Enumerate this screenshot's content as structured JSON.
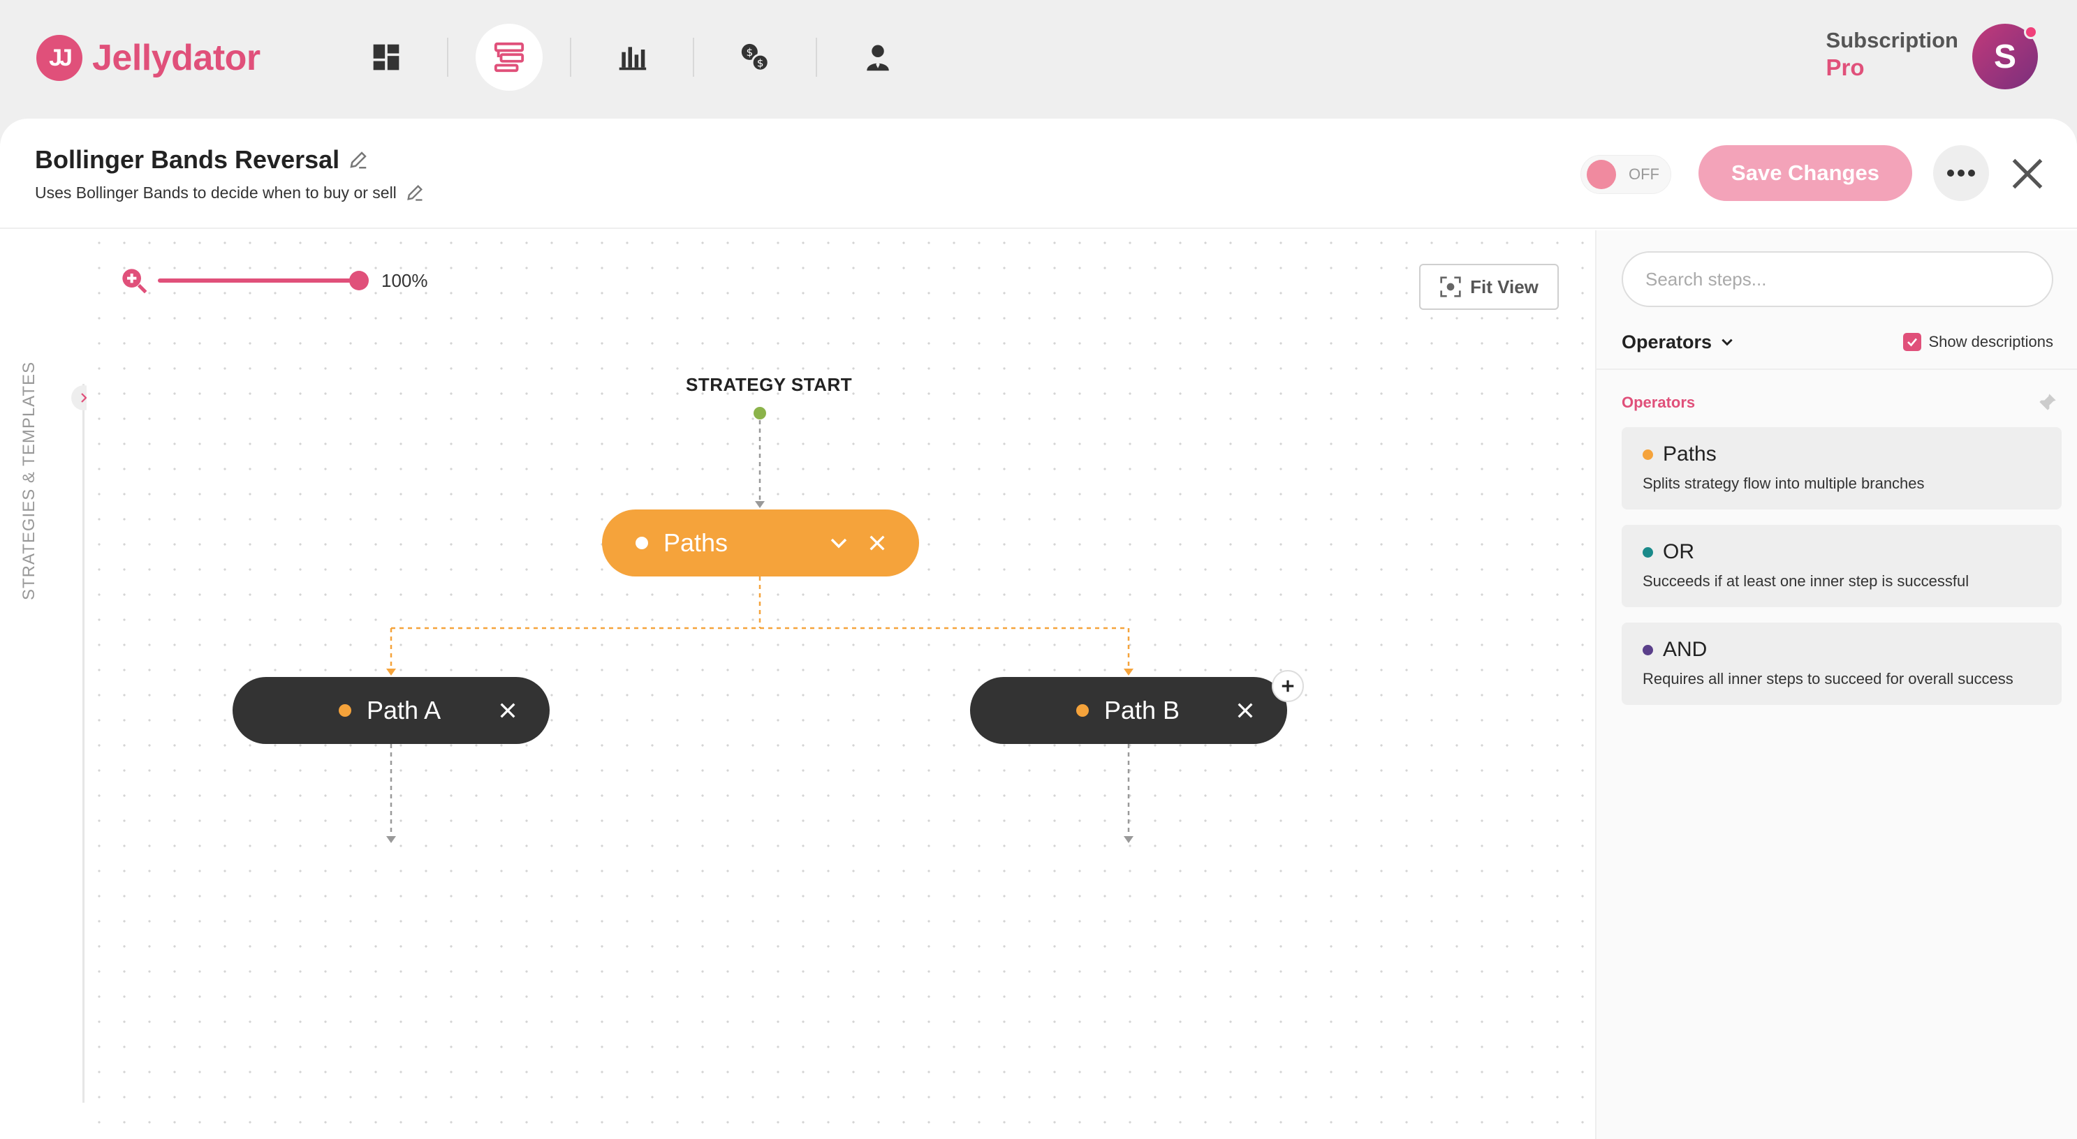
{
  "app": {
    "logo_mark": "JJ",
    "name": "Jellydator",
    "accent": "#e0507a"
  },
  "nav": [
    {
      "icon": "dashboard-icon",
      "active": false
    },
    {
      "icon": "strategy-builder-icon",
      "active": true
    },
    {
      "icon": "bar-chart-icon",
      "active": false
    },
    {
      "icon": "currency-exchange-icon",
      "active": false
    },
    {
      "icon": "user-icon",
      "active": false
    }
  ],
  "subscription": {
    "label": "Subscription",
    "plan": "Pro",
    "avatar_initial": "S"
  },
  "strategy": {
    "title": "Bollinger Bands Reversal",
    "description": "Uses Bollinger Bands to decide when to buy or sell"
  },
  "toolbar": {
    "toggle_label": "OFF",
    "save_label": "Save Changes"
  },
  "rail": {
    "label": "STRATEGIES & TEMPLATES"
  },
  "canvas": {
    "zoom_text": "100%",
    "zoom_level": 1.0,
    "fit_view_label": "Fit View",
    "start_label": "STRATEGY START",
    "nodes": {
      "paths": {
        "label": "Paths",
        "color": "#f5a33b"
      },
      "path_a": {
        "label": "Path A",
        "dot_color": "#f5a33b"
      },
      "path_b": {
        "label": "Path B",
        "dot_color": "#f5a33b"
      }
    }
  },
  "sidebar": {
    "search_placeholder": "Search steps...",
    "filter_label": "Operators",
    "show_descriptions_label": "Show descriptions",
    "section_title": "Operators",
    "operators": [
      {
        "name": "Paths",
        "description": "Splits strategy flow into multiple branches",
        "color": "#f5a33b"
      },
      {
        "name": "OR",
        "description": "Succeeds if at least one inner step is successful",
        "color": "#1a8a8a"
      },
      {
        "name": "AND",
        "description": "Requires all inner steps to succeed for overall success",
        "color": "#5a3f8a"
      }
    ]
  }
}
